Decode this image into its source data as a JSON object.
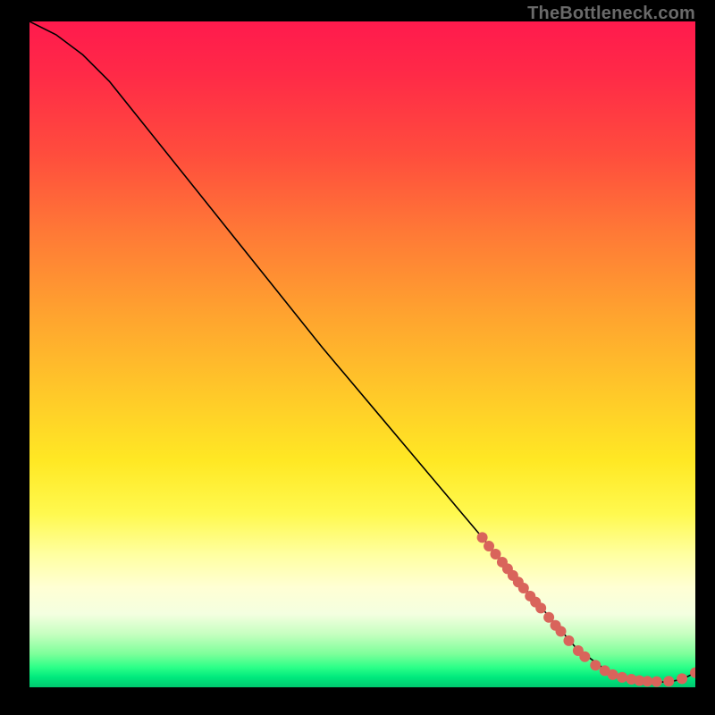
{
  "watermark": "TheBottleneck.com",
  "chart_data": {
    "type": "line",
    "title": "",
    "xlabel": "",
    "ylabel": "",
    "xlim": [
      0,
      100
    ],
    "ylim": [
      0,
      100
    ],
    "grid": false,
    "legend": false,
    "series": [
      {
        "name": "curve",
        "color": "#000000",
        "x": [
          0,
          4,
          8,
          12,
          16,
          20,
          28,
          36,
          44,
          52,
          60,
          68,
          76,
          82,
          86,
          88,
          90,
          92,
          94,
          96,
          98,
          100
        ],
        "y": [
          100,
          98,
          95,
          91,
          86,
          81,
          71,
          61,
          51,
          41.5,
          32,
          22.5,
          13,
          6,
          3,
          2,
          1.4,
          1,
          0.8,
          0.8,
          1.2,
          2.2
        ]
      }
    ],
    "points": [
      {
        "x": 68.0,
        "y": 22.5
      },
      {
        "x": 69.0,
        "y": 21.2
      },
      {
        "x": 70.0,
        "y": 20.0
      },
      {
        "x": 71.0,
        "y": 18.8
      },
      {
        "x": 71.8,
        "y": 17.8
      },
      {
        "x": 72.6,
        "y": 16.8
      },
      {
        "x": 73.4,
        "y": 15.8
      },
      {
        "x": 74.2,
        "y": 14.9
      },
      {
        "x": 75.2,
        "y": 13.7
      },
      {
        "x": 76.0,
        "y": 12.8
      },
      {
        "x": 76.8,
        "y": 11.9
      },
      {
        "x": 78.0,
        "y": 10.5
      },
      {
        "x": 79.0,
        "y": 9.3
      },
      {
        "x": 79.8,
        "y": 8.4
      },
      {
        "x": 81.0,
        "y": 7.0
      },
      {
        "x": 82.4,
        "y": 5.5
      },
      {
        "x": 83.4,
        "y": 4.6
      },
      {
        "x": 85.0,
        "y": 3.3
      },
      {
        "x": 86.4,
        "y": 2.5
      },
      {
        "x": 87.6,
        "y": 1.9
      },
      {
        "x": 89.0,
        "y": 1.5
      },
      {
        "x": 90.4,
        "y": 1.2
      },
      {
        "x": 91.6,
        "y": 1.0
      },
      {
        "x": 92.8,
        "y": 0.9
      },
      {
        "x": 94.2,
        "y": 0.85
      },
      {
        "x": 96.0,
        "y": 0.9
      },
      {
        "x": 98.0,
        "y": 1.3
      },
      {
        "x": 100.0,
        "y": 2.2
      }
    ],
    "point_color": "#d9645b",
    "point_radius": 6
  }
}
